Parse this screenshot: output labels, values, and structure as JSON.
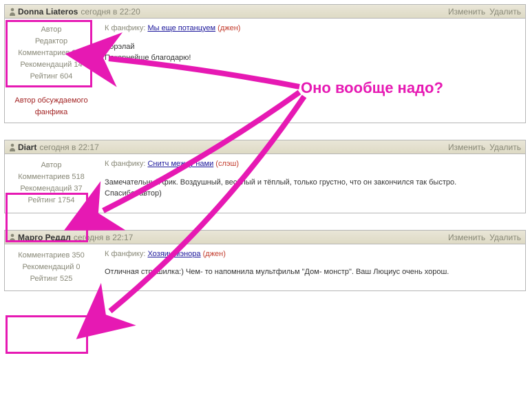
{
  "labels": {
    "fic_prefix": "К фанфику: ",
    "edit": "Изменить",
    "delete": "Удалить"
  },
  "annotation": {
    "question": "Оно вообще надо?"
  },
  "posts": [
    {
      "username": "Donna Liateros",
      "timestamp": "сегодня в 22:20",
      "stats": [
        "Автор",
        "Редактор",
        "Комментариев 212",
        "Рекомендаций 14",
        "Рейтинг 604"
      ],
      "author_of": "Автор обсуждаемого фанфика",
      "fic_link": "Мы еще потанцуем",
      "fic_genre": "(джен)",
      "body_lines": [
        "Лорэлай",
        "Покорнейше благодарю!"
      ]
    },
    {
      "username": "Diart",
      "timestamp": "сегодня в 22:17",
      "stats": [
        "Автор",
        "Комментариев 518",
        "Рекомендаций 37",
        "Рейтинг 1754"
      ],
      "author_of": "",
      "fic_link": "Снитч между нами",
      "fic_genre": "(слэш)",
      "body_lines": [
        "Замечательный фик. Воздушный, весёлый и тёплый, только грустно, что он закончился так быстро.",
        "Спасибо, автор)"
      ]
    },
    {
      "username": "Марго Реддл",
      "timestamp": "сегодня в 22:17",
      "stats": [
        "Комментариев 350",
        "Рекомендаций 0",
        "Рейтинг 525"
      ],
      "author_of": "",
      "fic_link": "Хозяин мэнора",
      "fic_genre": "(джен)",
      "body_lines": [
        "Отличная страшилка:) Чем- то напомнила мультфильм \"Дом- монстр\". Ваш Люциус очень хорош."
      ]
    }
  ]
}
